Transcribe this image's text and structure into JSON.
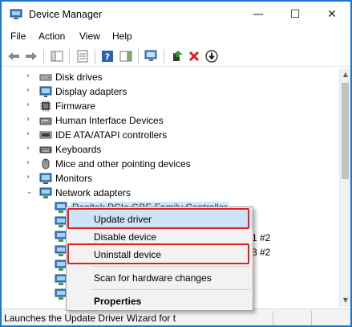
{
  "window": {
    "title": "Device Manager",
    "controls": {
      "minimize": "—",
      "maximize": "☐",
      "close": "✕"
    }
  },
  "menu": [
    "File",
    "Action",
    "View",
    "Help"
  ],
  "toolbar_icons": [
    "back-arrow-icon",
    "forward-arrow-icon",
    "show-hide-console-tree-icon",
    "properties-icon",
    "help-icon",
    "action-pane-icon",
    "scan-hardware-icon",
    "update-driver-icon",
    "uninstall-device-icon",
    "download-driver-icon"
  ],
  "tree": {
    "categories": [
      {
        "label": "Disk drives",
        "icon": "disk-drive-icon",
        "expanded": false
      },
      {
        "label": "Display adapters",
        "icon": "display-adapter-icon",
        "expanded": false
      },
      {
        "label": "Firmware",
        "icon": "firmware-icon",
        "expanded": false
      },
      {
        "label": "Human Interface Devices",
        "icon": "hid-icon",
        "expanded": false
      },
      {
        "label": "IDE ATA/ATAPI controllers",
        "icon": "ide-controller-icon",
        "expanded": false
      },
      {
        "label": "Keyboards",
        "icon": "keyboard-icon",
        "expanded": false
      },
      {
        "label": "Mice and other pointing devices",
        "icon": "mouse-icon",
        "expanded": false
      },
      {
        "label": "Monitors",
        "icon": "monitor-icon",
        "expanded": false
      },
      {
        "label": "Network adapters",
        "icon": "network-adapter-icon",
        "expanded": true
      }
    ],
    "selected_child": "Realtek PCIe GBE Family Controller",
    "partial_suffixes": [
      "1 #2",
      "8 #2"
    ]
  },
  "context_menu": {
    "items": [
      {
        "label": "Update driver",
        "highlighted": true,
        "boxed": true
      },
      {
        "label": "Disable device",
        "highlighted": false,
        "boxed": false
      },
      {
        "label": "Uninstall device",
        "highlighted": false,
        "boxed": true
      },
      {
        "label": "Scan for hardware changes",
        "highlighted": false,
        "boxed": false
      },
      {
        "label": "Properties",
        "highlighted": false,
        "boxed": false,
        "bold": true
      }
    ]
  },
  "status": {
    "text": "Launches the Update Driver Wizard for t"
  },
  "colors": {
    "window_border": "#1779d4",
    "highlight": "#cde4f8",
    "annotation_red": "#e02020",
    "selection": "#cce8ff"
  }
}
